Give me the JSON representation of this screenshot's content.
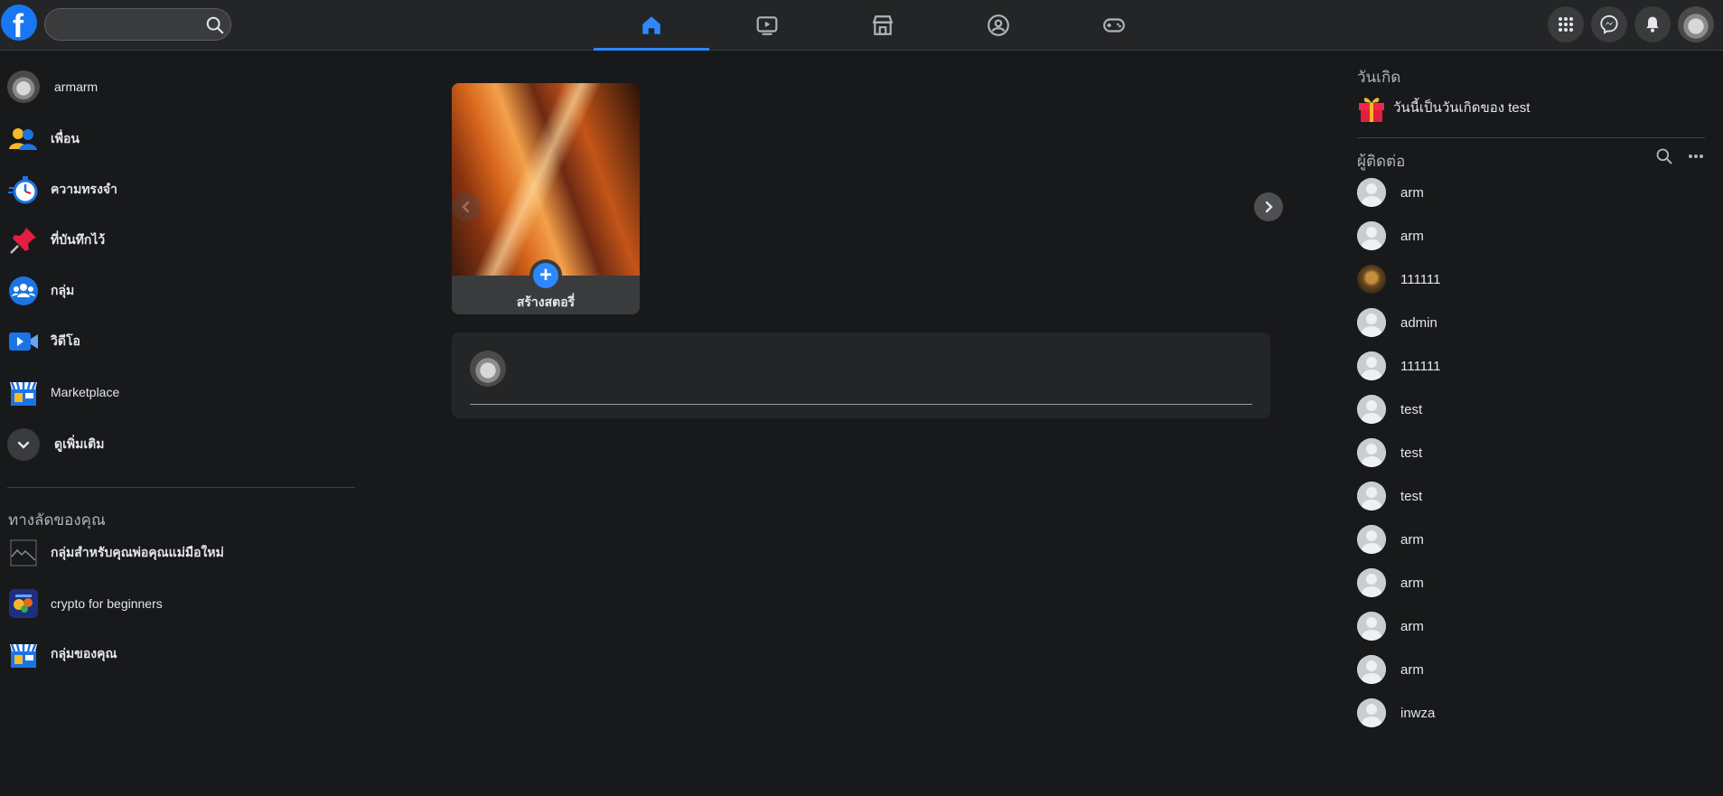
{
  "topbar": {
    "logo": "f",
    "search": {
      "value": "",
      "placeholder": ""
    },
    "nav_tabs": [
      {
        "name": "home",
        "icon": "home-icon",
        "active": true
      },
      {
        "name": "watch",
        "icon": "video-icon",
        "active": false
      },
      {
        "name": "marketplace",
        "icon": "shop-icon",
        "active": false
      },
      {
        "name": "groups",
        "icon": "groups-icon",
        "active": false
      },
      {
        "name": "gaming",
        "icon": "gamepad-icon",
        "active": false
      }
    ],
    "right_buttons": [
      "menu-grid-icon",
      "messenger-icon",
      "bell-icon",
      "profile-avatar"
    ],
    "accent_color": "#2d88ff"
  },
  "sidebar": {
    "profile_name": "armarm",
    "items": [
      {
        "label": "เพื่อน",
        "icon": "friends-icon"
      },
      {
        "label": "ความทรงจำ",
        "icon": "memories-clock-icon"
      },
      {
        "label": "ที่บันทึกไว้",
        "icon": "saved-pin-icon"
      },
      {
        "label": "กลุ่ม",
        "icon": "groups-icon"
      },
      {
        "label": "วิดีโอ",
        "icon": "video-icon"
      },
      {
        "label": "Marketplace",
        "icon": "marketplace-icon"
      }
    ],
    "see_more_label": "ดูเพิ่มเติม",
    "shortcuts_title": "ทางลัดของคุณ",
    "shortcuts": [
      {
        "label": "กลุ่มสำหรับคุณพ่อคุณแม่มือใหม่",
        "icon": "broken-image-icon"
      },
      {
        "label": "crypto for beginners",
        "icon": "crypto-group-icon"
      },
      {
        "label": "กลุ่มของคุณ",
        "icon": "marketplace-icon"
      }
    ]
  },
  "stories": {
    "create_label": "สร้างสตอรี่"
  },
  "right_panel": {
    "birthdays_title": "วันเกิด",
    "birthday_text": "วันนี้เป็นวันเกิดของ test",
    "contacts_title": "ผู้ติดต่อ",
    "contacts": [
      {
        "name": "arm",
        "avatar": "default"
      },
      {
        "name": "arm",
        "avatar": "default"
      },
      {
        "name": "111111",
        "avatar": "photo"
      },
      {
        "name": "admin",
        "avatar": "default"
      },
      {
        "name": "111111",
        "avatar": "default"
      },
      {
        "name": "test",
        "avatar": "default"
      },
      {
        "name": "test",
        "avatar": "default"
      },
      {
        "name": "test",
        "avatar": "default"
      },
      {
        "name": "arm",
        "avatar": "default"
      },
      {
        "name": "arm",
        "avatar": "default"
      },
      {
        "name": "arm",
        "avatar": "default"
      },
      {
        "name": "arm",
        "avatar": "default"
      },
      {
        "name": "inwza",
        "avatar": "default"
      }
    ]
  }
}
